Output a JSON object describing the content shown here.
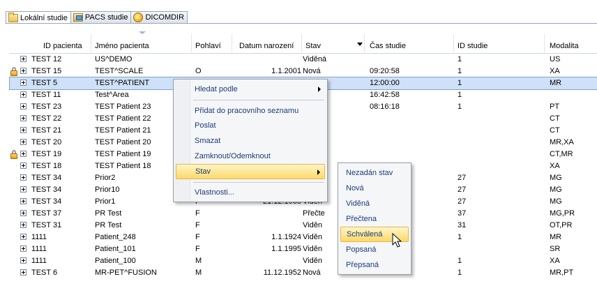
{
  "tabs": [
    {
      "label": "Lokální studie",
      "icon": "folder-icon",
      "active": true
    },
    {
      "label": "PACS studie",
      "icon": "pacs-icon",
      "active": false
    },
    {
      "label": "DICOMDIR",
      "icon": "dicomdir-icon",
      "active": false
    }
  ],
  "columns": {
    "id": "ID pacienta",
    "name": "Jméno pacienta",
    "sex": "Pohlaví",
    "dob": "Datum narození",
    "stav": "Stav",
    "time": "Čas studie",
    "study_id": "ID studie",
    "modality": "Modalita"
  },
  "rows": [
    {
      "id": "TEST 12",
      "name": "US^DEMO",
      "sex": "",
      "dob": "",
      "stav": "Viděná",
      "time": "",
      "study_id": "1",
      "modality": "US",
      "locked": false
    },
    {
      "id": "TEST 15",
      "name": "TEST^SCALE",
      "sex": "O",
      "dob": "1.1.2001",
      "stav": "Nová",
      "time": "09:20:58",
      "study_id": "1",
      "modality": "XA",
      "locked": true
    },
    {
      "id": "TEST 5",
      "name": "TEST^PATIENT",
      "sex": "",
      "dob": "",
      "stav": "á",
      "time": "12:00:00",
      "study_id": "1",
      "modality": "MR",
      "locked": false,
      "selected": true
    },
    {
      "id": "TEST 11",
      "name": "Test^Area",
      "sex": "",
      "dob": "",
      "stav": "á",
      "time": "16:42:58",
      "study_id": "1",
      "modality": "",
      "locked": false
    },
    {
      "id": "TEST 23",
      "name": "TEST Patient 23",
      "sex": "",
      "dob": "",
      "stav": "á",
      "time": "08:16:18",
      "study_id": "1",
      "modality": "PT",
      "locked": false
    },
    {
      "id": "TEST 22",
      "name": "TEST Patient 22",
      "sex": "",
      "dob": "",
      "stav": "",
      "time": "",
      "study_id": "",
      "modality": "CT",
      "locked": false
    },
    {
      "id": "TEST 21",
      "name": "TEST Patient 21",
      "sex": "",
      "dob": "",
      "stav": "",
      "time": "",
      "study_id": "",
      "modality": "CT",
      "locked": false
    },
    {
      "id": "TEST 20",
      "name": "TEST Patient 20",
      "sex": "",
      "dob": "",
      "stav": "",
      "time": "",
      "study_id": "",
      "modality": "MR,XA",
      "locked": false
    },
    {
      "id": "TEST 19",
      "name": "TEST Patient 19",
      "sex": "",
      "dob": "",
      "stav": "",
      "time": "",
      "study_id": "",
      "modality": "CT,MR",
      "locked": true
    },
    {
      "id": "TEST 18",
      "name": "TEST Patient 18",
      "sex": "",
      "dob": "",
      "stav": "",
      "time": "",
      "study_id": "",
      "modality": "XA",
      "locked": false
    },
    {
      "id": "TEST 34",
      "name": "Prior2",
      "sex": "",
      "dob": "",
      "stav": "",
      "time": "",
      "study_id": "27",
      "modality": "MG",
      "locked": false
    },
    {
      "id": "TEST 34",
      "name": "Prior10",
      "sex": "",
      "dob": "",
      "stav": "",
      "time": "",
      "study_id": "27",
      "modality": "MG",
      "locked": false
    },
    {
      "id": "TEST 34",
      "name": "Prior1",
      "sex": "F",
      "dob": "21.12.1965",
      "stav": "Viděn",
      "time": "",
      "study_id": "27",
      "modality": "MG",
      "locked": false
    },
    {
      "id": "TEST 37",
      "name": "PR Test",
      "sex": "F",
      "dob": "",
      "stav": "Přečte",
      "time": "",
      "study_id": "37",
      "modality": "MG,PR",
      "locked": false
    },
    {
      "id": "TEST 31",
      "name": "PR Test",
      "sex": "F",
      "dob": "",
      "stav": "Viděn",
      "time": "",
      "study_id": "31",
      "modality": "OT,PR",
      "locked": false
    },
    {
      "id": "1111",
      "name": "Patient_248",
      "sex": "F",
      "dob": "1.1.1924",
      "stav": "Viděn",
      "time": "",
      "study_id": "1",
      "modality": "MR",
      "locked": false
    },
    {
      "id": "1111",
      "name": "Patient_101",
      "sex": "F",
      "dob": "1.1.1995",
      "stav": "Viděn",
      "time": "",
      "study_id": "",
      "modality": "SR",
      "locked": false
    },
    {
      "id": "1111",
      "name": "Patient_100",
      "sex": "M",
      "dob": "",
      "stav": "Viděn",
      "time": "",
      "study_id": "1",
      "modality": "XA",
      "locked": false
    },
    {
      "id": "TEST 6",
      "name": "MR-PET^FUSION",
      "sex": "M",
      "dob": "11.12.1952",
      "stav": "Nová",
      "time": "09:25:19",
      "study_id": "1",
      "modality": "MR,PT",
      "locked": false
    }
  ],
  "context_menu": {
    "items": [
      "Hledat podle",
      "Přidat do pracovního seznamu",
      "Poslat",
      "Smazat",
      "Zamknout/Odemknout",
      "Stav",
      "Vlastnosti..."
    ],
    "highlighted": "Stav"
  },
  "submenu": {
    "items": [
      "Nezadán stav",
      "Nová",
      "Viděná",
      "Přečtena",
      "Schválená",
      "Popsaná",
      "Přepsaná"
    ],
    "highlighted": "Schválená"
  },
  "colors": {
    "selection": "#cfe1f8",
    "menu_highlight": "#fcd86a",
    "menu_text": "#1b3b78"
  }
}
